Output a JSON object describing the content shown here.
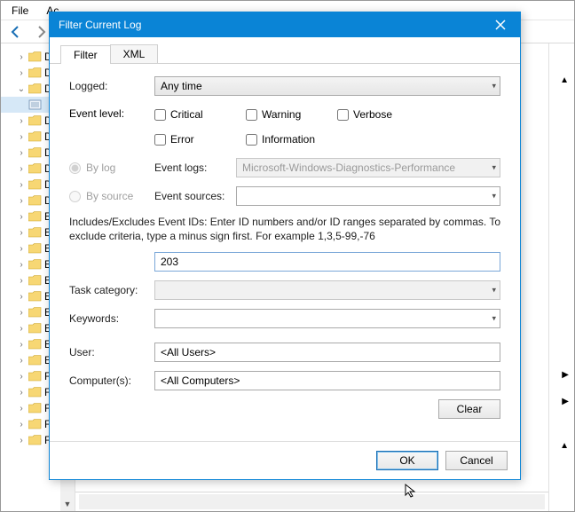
{
  "menubar": {
    "file": "File",
    "action": "Ac"
  },
  "tree": {
    "items": [
      {
        "label": "Dia",
        "exp": ">"
      },
      {
        "label": "Dia",
        "exp": ">"
      },
      {
        "label": "Dia",
        "exp": "v",
        "sel": false
      },
      {
        "label": "",
        "exp": "",
        "sel": true,
        "icon": "log"
      },
      {
        "label": "Disk",
        "exp": ">"
      },
      {
        "label": "Disk",
        "exp": ">"
      },
      {
        "label": "Disk",
        "exp": ">"
      },
      {
        "label": "Disp",
        "exp": ">"
      },
      {
        "label": "DN",
        "exp": ">"
      },
      {
        "label": "Driv",
        "exp": ">"
      },
      {
        "label": "Eap",
        "exp": ">"
      },
      {
        "label": "Eap",
        "exp": ">"
      },
      {
        "label": "Eap",
        "exp": ">"
      },
      {
        "label": "Eap",
        "exp": ">"
      },
      {
        "label": "EDP",
        "exp": ">"
      },
      {
        "label": "EDP",
        "exp": ">"
      },
      {
        "label": "Ene",
        "exp": ">"
      },
      {
        "label": "ESE",
        "exp": ">"
      },
      {
        "label": "Eve",
        "exp": ">"
      },
      {
        "label": "Eve",
        "exp": ">"
      },
      {
        "label": "Faul",
        "exp": ">"
      },
      {
        "label": "File",
        "exp": ">"
      },
      {
        "label": "File",
        "exp": ">"
      },
      {
        "label": "FM",
        "exp": ">"
      },
      {
        "label": "Fol",
        "exp": ">"
      }
    ]
  },
  "dialog": {
    "title": "Filter Current Log",
    "tabs": {
      "filter": "Filter",
      "xml": "XML"
    },
    "labels": {
      "logged": "Logged:",
      "event_level": "Event level:",
      "by_log": "By log",
      "by_source": "By source",
      "event_logs": "Event logs:",
      "event_sources": "Event sources:",
      "task_category": "Task category:",
      "keywords": "Keywords:",
      "user": "User:",
      "computers": "Computer(s):"
    },
    "logged_value": "Any time",
    "levels": {
      "critical": "Critical",
      "warning": "Warning",
      "verbose": "Verbose",
      "error": "Error",
      "information": "Information"
    },
    "event_logs_value": "Microsoft-Windows-Diagnostics-Performance",
    "hint": "Includes/Excludes Event IDs: Enter ID numbers and/or ID ranges separated by commas. To exclude criteria, type a minus sign first. For example 1,3,5-99,-76",
    "event_id_value": "203",
    "user_value": "<All Users>",
    "computers_value": "<All Computers>",
    "buttons": {
      "clear": "Clear",
      "ok": "OK",
      "cancel": "Cancel"
    }
  }
}
